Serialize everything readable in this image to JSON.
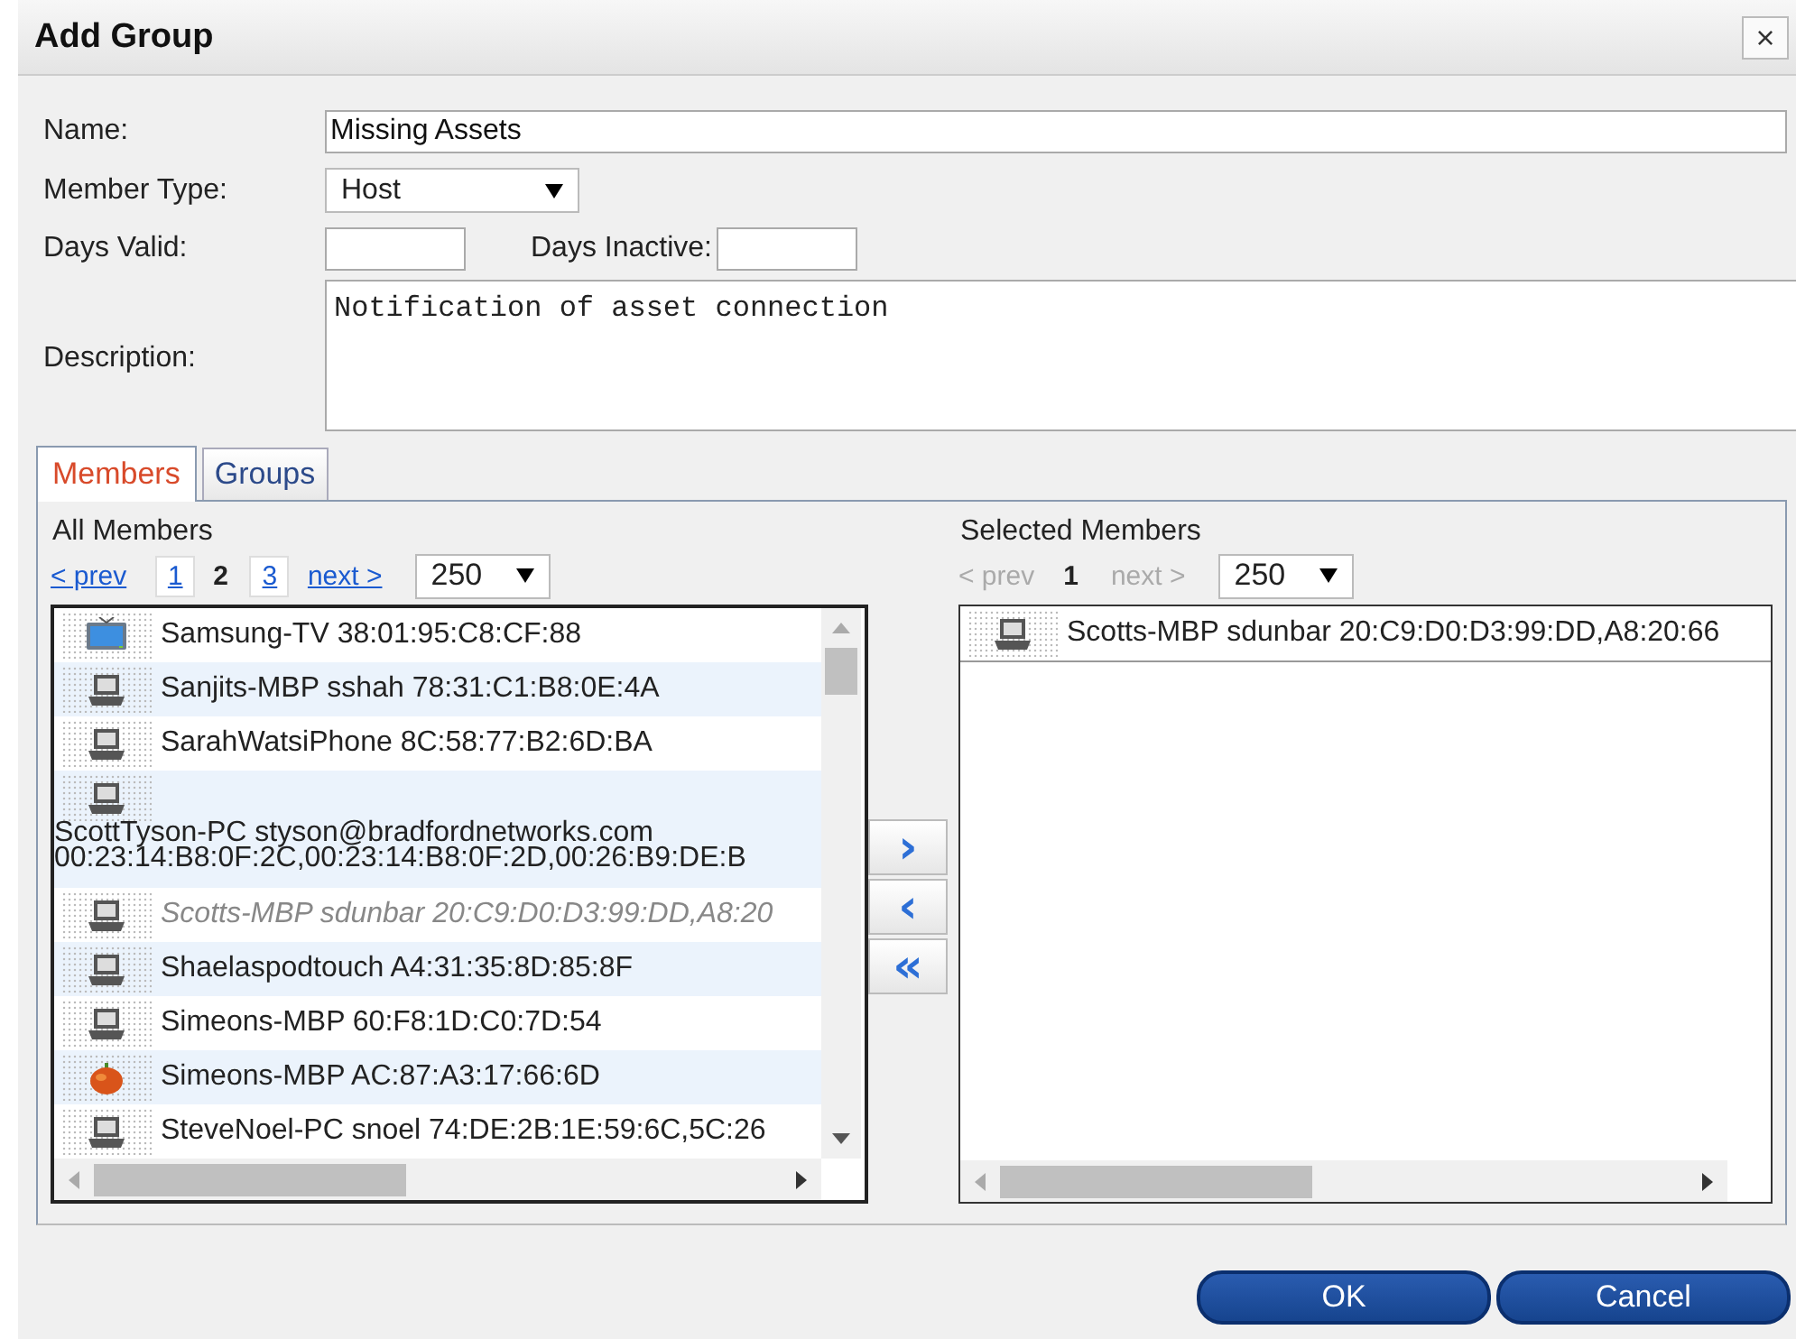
{
  "window": {
    "title": "Add Group",
    "close": "×"
  },
  "form": {
    "name_label": "Name:",
    "name_value": "Missing Assets",
    "member_type_label": "Member Type:",
    "member_type_value": "Host",
    "days_valid_label": "Days Valid:",
    "days_inactive_label": "Days Inactive:",
    "description_label": "Description:",
    "description_value": "Notification of asset connection"
  },
  "tabs": [
    {
      "label": "Members",
      "selected": true
    },
    {
      "label": "Groups",
      "selected": false
    }
  ],
  "all_members": {
    "title": "All Members",
    "prev": "< prev",
    "next": "next >",
    "pages": [
      {
        "label": "1",
        "selected": false
      },
      {
        "label": "2",
        "selected": true
      },
      {
        "label": "3",
        "selected": false
      }
    ],
    "page_size": "250",
    "rows": [
      {
        "kind": "tv",
        "text": "Samsung-TV 38:01:95:C8:CF:88",
        "disabled": false
      },
      {
        "kind": "computer",
        "text": "Sanjits-MBP sshah 78:31:C1:B8:0E:4A",
        "disabled": false
      },
      {
        "kind": "computer",
        "text": "SarahWatsiPhone 8C:58:77:B2:6D:BA",
        "disabled": false
      },
      {
        "kind": "computer",
        "lines": [
          "ScottTyson-PC styson@bradfordnetworks.com",
          "00:23:14:B8:0F:2C,00:23:14:B8:0F:2D,00:26:B9:DE:B"
        ],
        "disabled": false
      },
      {
        "kind": "computer",
        "text": "Scotts-MBP sdunbar 20:C9:D0:D3:99:DD,A8:20",
        "disabled": true
      },
      {
        "kind": "computer",
        "text": "Shaelaspodtouch A4:31:35:8D:85:8F",
        "disabled": false
      },
      {
        "kind": "computer",
        "text": "Simeons-MBP 60:F8:1D:C0:7D:54",
        "disabled": false
      },
      {
        "kind": "fruit",
        "text": "Simeons-MBP AC:87:A3:17:66:6D",
        "disabled": false
      },
      {
        "kind": "computer",
        "text": "SteveNoel-PC snoel 74:DE:2B:1E:59:6C,5C:26",
        "disabled": false
      }
    ]
  },
  "move_buttons": [
    {
      "label": "›"
    },
    {
      "label": "‹"
    },
    {
      "label": "«"
    }
  ],
  "selected_members": {
    "title": "Selected Members",
    "prev": "< prev",
    "next": "next >",
    "pages": [
      {
        "label": "1",
        "selected": true
      }
    ],
    "page_size": "250",
    "rows": [
      {
        "kind": "computer",
        "text": "Scotts-MBP sdunbar 20:C9:D0:D3:99:DD,A8:20:66",
        "disabled": false
      }
    ]
  },
  "buttons": [
    {
      "label": "OK"
    },
    {
      "label": "Cancel"
    }
  ]
}
